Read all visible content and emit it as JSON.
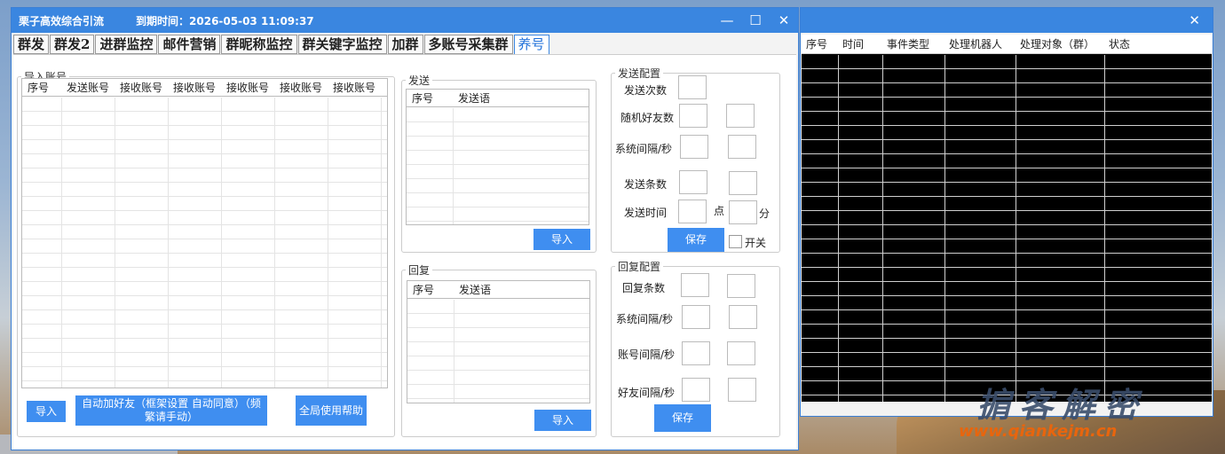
{
  "app": {
    "title": "栗子高效综合引流",
    "expire": "到期时间：2026-05-03 11:09:37"
  },
  "window_controls": {
    "minimize": "—",
    "maximize": "☐",
    "close": "✕"
  },
  "tabs": [
    "群发",
    "群发2",
    "进群监控",
    "邮件营销",
    "群昵称监控",
    "群关键字监控",
    "加群",
    "多账号采集群",
    "养号"
  ],
  "active_tab": "养号",
  "import_section": {
    "legend": "导入账号",
    "columns": [
      "序号",
      "发送账号",
      "接收账号",
      "接收账号",
      "接收账号",
      "接收账号",
      "接收账号"
    ],
    "buttons": {
      "import": "导入",
      "auto_add": "自动加好友（框架设置 自动同意）（频繁请手动）",
      "help": "全局使用帮助"
    }
  },
  "send_section": {
    "legend": "发送",
    "columns": [
      "序号",
      "发送语"
    ],
    "import_button": "导入"
  },
  "reply_section": {
    "legend": "回复",
    "columns": [
      "序号",
      "发送语"
    ],
    "import_button": "导入"
  },
  "send_config": {
    "legend": "发送配置",
    "send_count": "发送次数",
    "random_friends": "随机好友数",
    "system_interval": "系统间隔/秒",
    "send_items": "发送条数",
    "send_time": "发送时间",
    "hour_unit": "点",
    "minute_unit": "分",
    "save": "保存",
    "toggle": "开关"
  },
  "reply_config": {
    "legend": "回复配置",
    "reply_items": "回复条数",
    "system_interval": "系统间隔/秒",
    "account_interval": "账号间隔/秒",
    "friend_interval": "好友间隔/秒",
    "save": "保存"
  },
  "log_window": {
    "close": "✕",
    "columns": [
      "序号",
      "时间",
      "事件类型",
      "处理机器人",
      "处理对象（群）",
      "状态"
    ]
  },
  "watermark": {
    "cn": "掮客解密",
    "url": "www.qiankejm.cn"
  },
  "colors": {
    "titlebar": "#3a86e0",
    "button": "#3f8ef0",
    "active_tab": "#1e6fd9"
  }
}
